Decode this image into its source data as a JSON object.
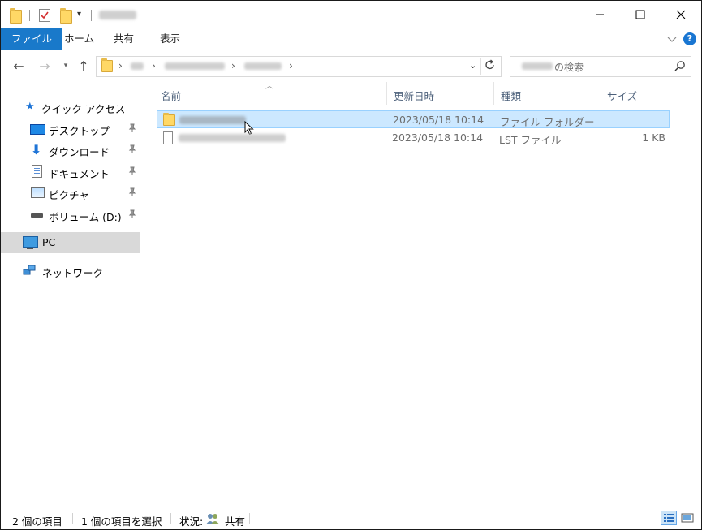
{
  "ribbon": {
    "tabs": [
      {
        "label": "ファイル"
      },
      {
        "label": "ホーム"
      },
      {
        "label": "共有"
      },
      {
        "label": "表示"
      }
    ]
  },
  "search": {
    "placeholder": "の検索"
  },
  "nav": {
    "quick_access": "クイック アクセス",
    "items": [
      {
        "label": "デスクトップ"
      },
      {
        "label": "ダウンロード"
      },
      {
        "label": "ドキュメント"
      },
      {
        "label": "ピクチャ"
      },
      {
        "label": "ボリューム (D:)"
      }
    ],
    "pc": "PC",
    "network": "ネットワーク"
  },
  "columns": {
    "name": "名前",
    "modified": "更新日時",
    "type": "種類",
    "size": "サイズ"
  },
  "files": [
    {
      "modified": "2023/05/18 10:14",
      "type": "ファイル フォルダー",
      "size": ""
    },
    {
      "modified": "2023/05/18 10:14",
      "type": "LST ファイル",
      "size": "1 KB"
    }
  ],
  "status": {
    "count": "2 個の項目",
    "selected": "1 個の項目を選択",
    "state_label": "状況:",
    "state_value": "共有"
  },
  "colors": {
    "file_tab": "#1979ca",
    "selection": "#cce8ff",
    "selection_border": "#99d1ff",
    "header_text": "#4c607a"
  }
}
